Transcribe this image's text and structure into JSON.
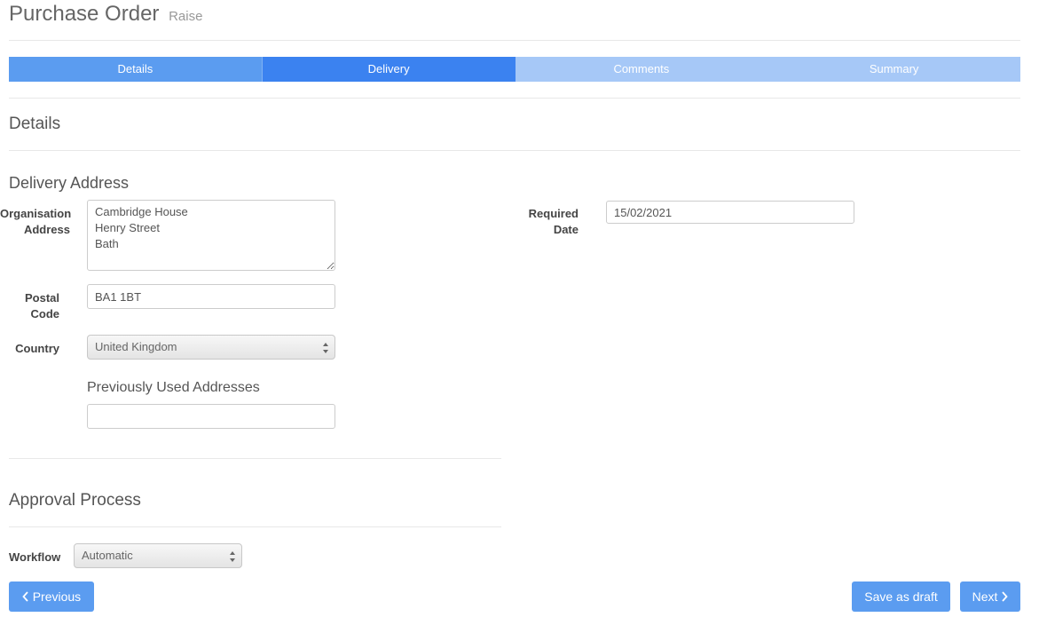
{
  "header": {
    "title": "Purchase Order",
    "subtitle": "Raise"
  },
  "wizard": {
    "steps": [
      {
        "label": "Details",
        "state": "done"
      },
      {
        "label": "Delivery",
        "state": "active"
      },
      {
        "label": "Comments",
        "state": "todo"
      },
      {
        "label": "Summary",
        "state": "todo"
      }
    ]
  },
  "details": {
    "heading": "Details"
  },
  "delivery": {
    "heading": "Delivery Address",
    "org_address_label_1": "Organisation",
    "org_address_label_2": "Address",
    "org_address_value": "Cambridge House\nHenry Street\nBath",
    "postal_code_label_1": "Postal",
    "postal_code_label_2": "Code",
    "postal_code_value": "BA1 1BT",
    "country_label": "Country",
    "country_value": "United Kingdom",
    "prev_addresses_label": "Previously Used Addresses",
    "prev_addresses_value": "",
    "required_date_label_1": "Required",
    "required_date_label_2": "Date",
    "required_date_value": "15/02/2021"
  },
  "approval": {
    "heading": "Approval Process",
    "workflow_label": "Workflow",
    "workflow_value": "Automatic"
  },
  "footer": {
    "previous_label": "Previous",
    "save_draft_label": "Save as draft",
    "next_label": "Next"
  },
  "colors": {
    "step_done": "#5b9cf0",
    "step_active": "#3b82f0",
    "step_todo": "#a6c8f7",
    "button": "#5b9cf0"
  }
}
